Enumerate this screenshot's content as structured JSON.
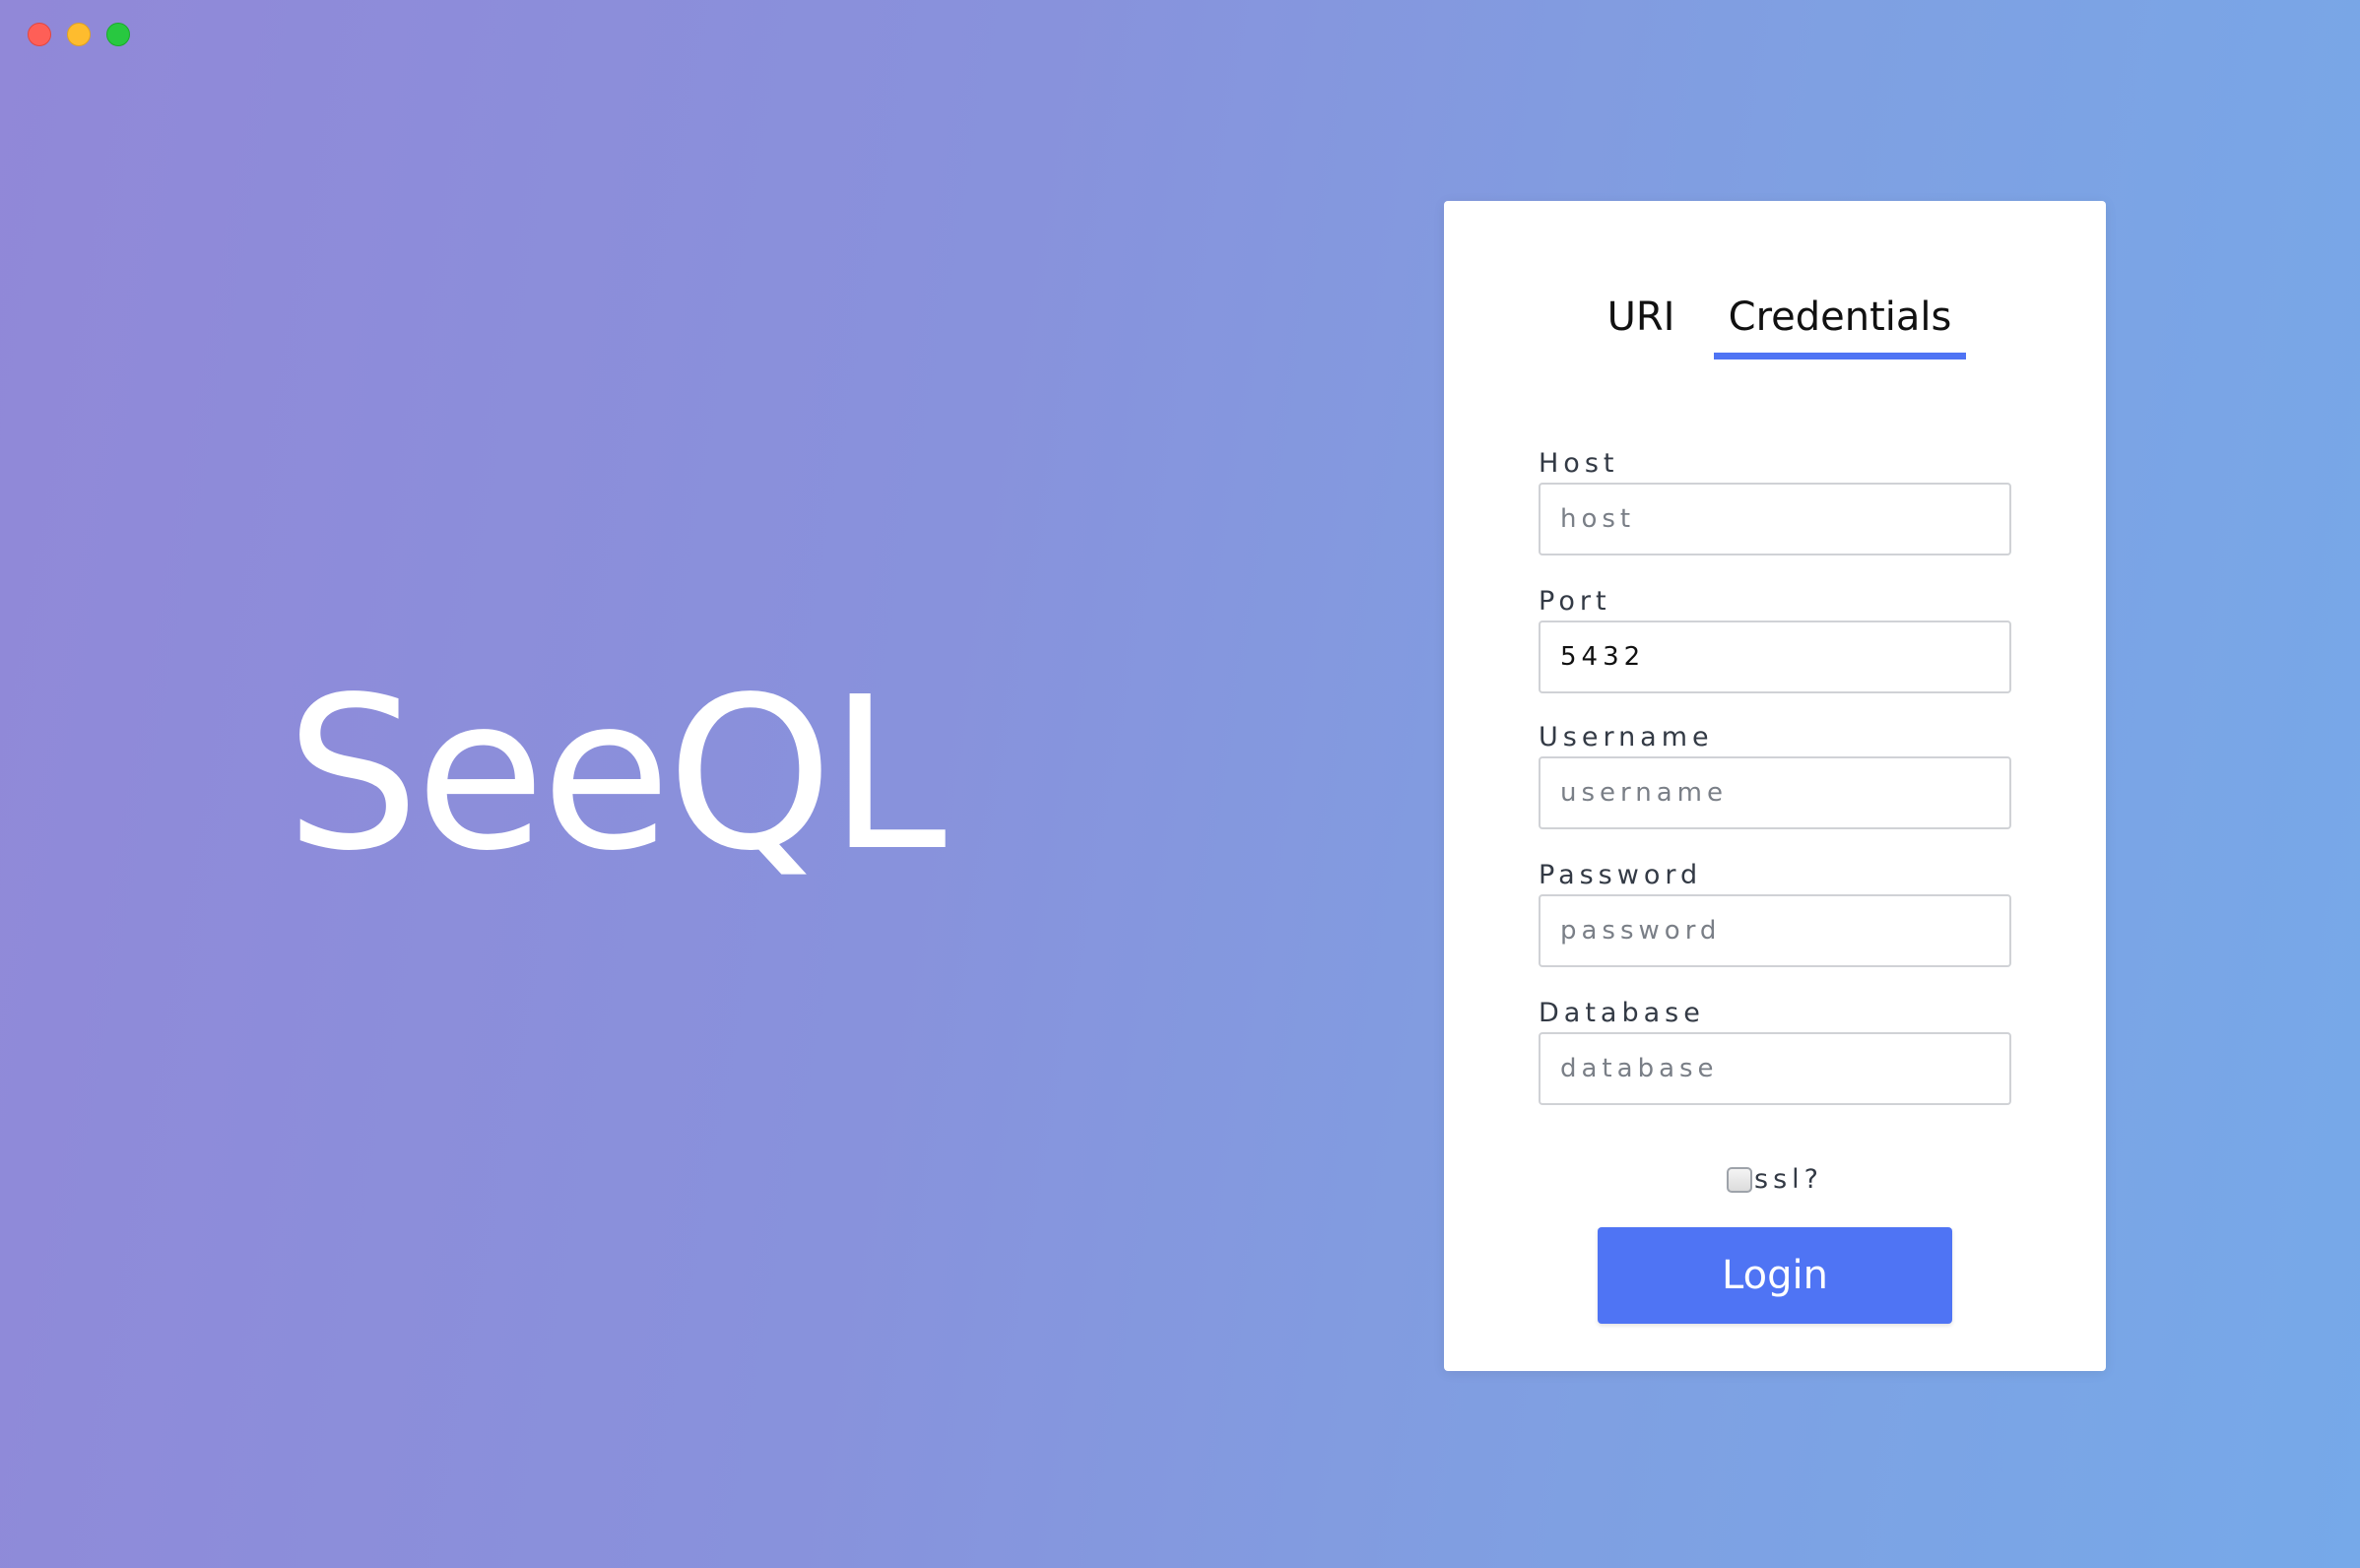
{
  "window": {
    "controls": [
      "close",
      "minimize",
      "zoom"
    ]
  },
  "app": {
    "logo_text": "SeeQL"
  },
  "tabs": [
    {
      "label": "URI",
      "active": false
    },
    {
      "label": "Credentials",
      "active": true
    }
  ],
  "form": {
    "host": {
      "label": "Host",
      "value": "",
      "placeholder": "host"
    },
    "port": {
      "label": "Port",
      "value": "5432",
      "placeholder": ""
    },
    "username": {
      "label": "Username",
      "value": "",
      "placeholder": "username"
    },
    "password": {
      "label": "Password",
      "value": "",
      "placeholder": "password"
    },
    "database": {
      "label": "Database",
      "value": "",
      "placeholder": "database"
    },
    "ssl": {
      "label": "ssl?",
      "checked": false
    },
    "login_label": "Login"
  },
  "colors": {
    "accent": "#4f74f4",
    "background_start": "#9188d8",
    "background_end": "#76a9e9",
    "card": "#ffffff"
  }
}
